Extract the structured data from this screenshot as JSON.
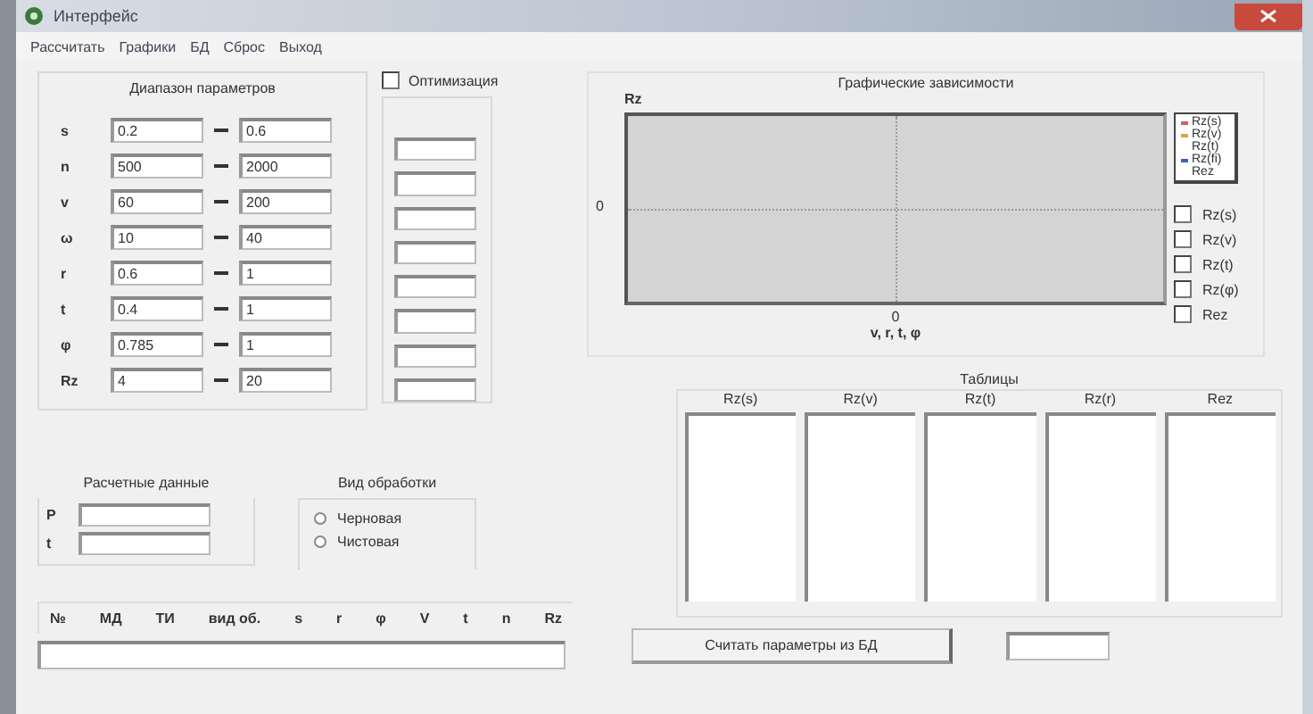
{
  "window": {
    "title": "Интерфейс"
  },
  "menu": [
    "Рассчитать",
    "Графики",
    "БД",
    "Сброс",
    "Выход"
  ],
  "params": {
    "title": "Диапазон параметров",
    "optimization": {
      "label": "Оптимизация",
      "checked": false
    },
    "rows": [
      {
        "symbol": "s",
        "from": "0.2",
        "to": "0.6"
      },
      {
        "symbol": "n",
        "from": "500",
        "to": "2000"
      },
      {
        "symbol": "v",
        "from": "60",
        "to": "200"
      },
      {
        "symbol": "ω",
        "from": "10",
        "to": "40"
      },
      {
        "symbol": "r",
        "from": "0.6",
        "to": "1"
      },
      {
        "symbol": "t",
        "from": "0.4",
        "to": "1"
      },
      {
        "symbol": "φ",
        "from": "0.785",
        "to": "1"
      },
      {
        "symbol": "Rz",
        "from": "4",
        "to": "20"
      }
    ]
  },
  "calc": {
    "title": "Расчетные данные",
    "fields": [
      {
        "label": "P"
      },
      {
        "label": "t"
      }
    ]
  },
  "processing": {
    "title": "Вид обработки",
    "options": [
      {
        "label": "Черновая",
        "selected": false
      },
      {
        "label": "Чистовая",
        "selected": false
      }
    ]
  },
  "results": {
    "columns": [
      "№",
      "МД",
      "ТИ",
      "вид об.",
      "s",
      "r",
      "φ",
      "V",
      "t",
      "n",
      "Rz"
    ]
  },
  "graph": {
    "title": "Графические зависимости",
    "y_label": "Rz",
    "y_zero": "0",
    "x_zero": "0",
    "x_label": "v, r, t, φ",
    "legend": [
      {
        "label": "Rz(s)",
        "color": "#d06060"
      },
      {
        "label": "Rz(v)",
        "color": "#e0a040"
      },
      {
        "label": "Rz(t)"
      },
      {
        "label": "Rz(fi)",
        "color": "#4060c0"
      },
      {
        "label": "Rez"
      }
    ],
    "checkboxes": [
      {
        "label": "Rz(s)",
        "checked": false
      },
      {
        "label": "Rz(v)",
        "checked": false
      },
      {
        "label": "Rz(t)",
        "checked": false
      },
      {
        "label": "Rz(φ)",
        "checked": false
      },
      {
        "label": "Rez",
        "checked": false
      }
    ]
  },
  "tables": {
    "title": "Таблицы",
    "columns": [
      "Rz(s)",
      "Rz(v)",
      "Rz(t)",
      "Rz(r)",
      "Rez"
    ]
  },
  "load_button": "Считать параметры из БД"
}
